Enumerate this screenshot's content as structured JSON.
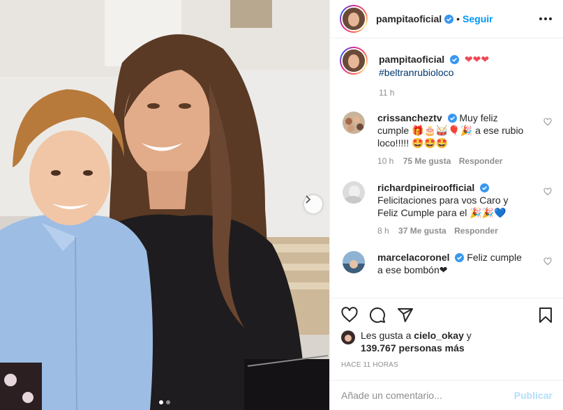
{
  "post": {
    "author": "pampitaoficial",
    "follow_label": "Seguir",
    "separator": "•"
  },
  "caption": {
    "username": "pampitaoficial",
    "emojis": "❤❤❤",
    "hashtag": "#beltranrubioloco",
    "time": "11 h"
  },
  "comments": [
    {
      "username": "crissancheztv",
      "text": "Muy feliz cumple 🎁🎂🥁🎈🎉 a ese rubio loco!!!!! 🤩🤩🤩",
      "time": "10 h",
      "likes": "75 Me gusta",
      "reply": "Responder"
    },
    {
      "username": "richardpineiroofficial",
      "text": "Felicitaciones para vos Caro y Feliz Cumple para el 🎉🎉💙",
      "time": "8 h",
      "likes": "37 Me gusta",
      "reply": "Responder"
    },
    {
      "username": "marcelacoronel",
      "text": "Feliz cumple a ese bombón❤"
    }
  ],
  "likes": {
    "prefix": "Les gusta a",
    "user": "cielo_okay",
    "conj": "y",
    "count": "139.767 personas más"
  },
  "ago": "HACE 11 HORAS",
  "add_comment": {
    "placeholder": "Añade un comentario...",
    "publish": "Publicar"
  },
  "colors": {
    "accent": "#0095f6",
    "verified": "#3897f0",
    "publish_disabled": "#b2dffc",
    "heart_red": "#ed4956"
  },
  "icons": [
    "verified-icon",
    "more-icon",
    "heart-icon",
    "comment-icon",
    "share-icon",
    "bookmark-icon",
    "chevron-right-icon"
  ]
}
